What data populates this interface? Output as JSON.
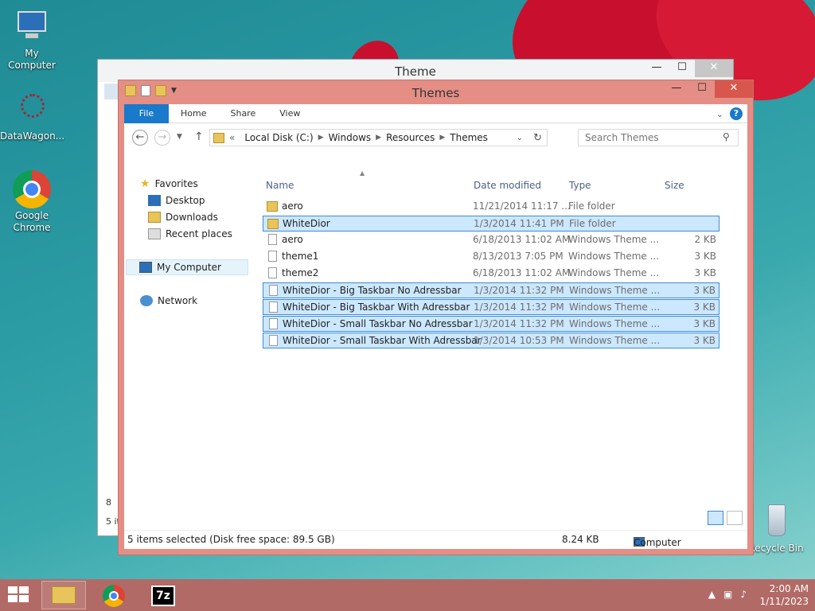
{
  "desktop": {
    "icons": [
      {
        "label": "My Computer",
        "icon": "computer-icon"
      },
      {
        "label": "DataWagon...",
        "icon": "datawagon-icon"
      },
      {
        "label": "Google Chrome",
        "icon": "chrome-icon"
      },
      {
        "label": "Recycle Bin",
        "icon": "recycle-bin-icon"
      }
    ]
  },
  "back_window": {
    "title": "Theme",
    "status_left": "5 it",
    "side_label": "8"
  },
  "window": {
    "title": "Themes",
    "controls": {
      "minimize": "—",
      "maximize": "☐",
      "close": "✕"
    },
    "ribbon_tabs": [
      "File",
      "Home",
      "Share",
      "View"
    ],
    "address": {
      "prefix": "«",
      "segments": [
        "Local Disk (C:)",
        "Windows",
        "Resources",
        "Themes"
      ]
    },
    "search_placeholder": "Search Themes",
    "nav": {
      "favorites": "Favorites",
      "desktop": "Desktop",
      "downloads": "Downloads",
      "recent": "Recent places",
      "my_computer": "My Computer",
      "network": "Network"
    },
    "columns": {
      "name": "Name",
      "date": "Date modified",
      "type": "Type",
      "size": "Size"
    },
    "files": [
      {
        "name": "aero",
        "date": "11/21/2014 11:17 ...",
        "type": "File folder",
        "size": "",
        "kind": "folder",
        "selected": false
      },
      {
        "name": "WhiteDior",
        "date": "1/3/2014 11:41 PM",
        "type": "File folder",
        "size": "",
        "kind": "folder",
        "selected": true
      },
      {
        "name": "aero",
        "date": "6/18/2013 11:02 AM",
        "type": "Windows Theme ...",
        "size": "2 KB",
        "kind": "file",
        "selected": false
      },
      {
        "name": "theme1",
        "date": "8/13/2013 7:05 PM",
        "type": "Windows Theme ...",
        "size": "3 KB",
        "kind": "file",
        "selected": false
      },
      {
        "name": "theme2",
        "date": "6/18/2013 11:02 AM",
        "type": "Windows Theme ...",
        "size": "3 KB",
        "kind": "file",
        "selected": false
      },
      {
        "name": "WhiteDior - Big Taskbar No Adressbar",
        "date": "1/3/2014 11:32 PM",
        "type": "Windows Theme ...",
        "size": "3 KB",
        "kind": "file",
        "selected": true
      },
      {
        "name": "WhiteDior - Big Taskbar With Adressbar",
        "date": "1/3/2014 11:32 PM",
        "type": "Windows Theme ...",
        "size": "3 KB",
        "kind": "file",
        "selected": true
      },
      {
        "name": "WhiteDior - Small Taskbar No Adressbar",
        "date": "1/3/2014 11:32 PM",
        "type": "Windows Theme ...",
        "size": "3 KB",
        "kind": "file",
        "selected": true
      },
      {
        "name": "WhiteDior - Small Taskbar With Adressbar",
        "date": "1/3/2014 10:53 PM",
        "type": "Windows Theme ...",
        "size": "3 KB",
        "kind": "file",
        "selected": true
      }
    ],
    "status": {
      "selection": "5 items selected (Disk free space: 89.5 GB)",
      "size": "8.24 KB",
      "location": "Computer"
    }
  },
  "taskbar": {
    "items": [
      {
        "name": "taskbar-file-explorer",
        "icon": "folder-icon"
      },
      {
        "name": "taskbar-chrome",
        "icon": "chrome-icon"
      },
      {
        "name": "taskbar-7zip",
        "icon": "7zip-icon",
        "label": "7z"
      }
    ],
    "time": "2:00 AM",
    "date": "1/11/2023"
  },
  "colors": {
    "titlebar": "#e48e86",
    "file_tab": "#1979ca",
    "selection": "#cce8ff",
    "taskbar": "#b26a66"
  }
}
